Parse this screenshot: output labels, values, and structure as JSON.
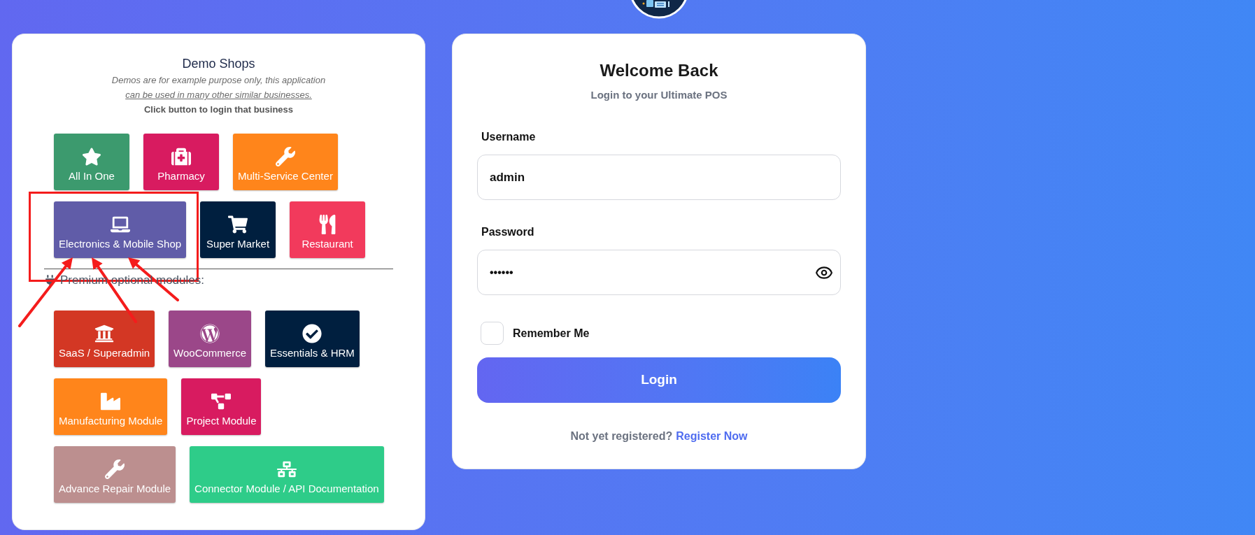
{
  "demo_shops": {
    "title": "Demo Shops",
    "note": "Demos are for example purpose only, this application",
    "note_link": "can be used in many other similar businesses.",
    "instruction": "Click button to login that business",
    "buttons": [
      {
        "label": "All In One",
        "color": "#3c9a6e"
      },
      {
        "label": "Pharmacy",
        "color": "#d81b60"
      },
      {
        "label": "Multi-Service Center",
        "color": "#ff851b"
      },
      {
        "label": "Electronics & Mobile Shop",
        "color": "#605ca8"
      },
      {
        "label": "Super Market",
        "color": "#001f3f"
      },
      {
        "label": "Restaurant",
        "color": "#f23a5c"
      }
    ]
  },
  "modules": {
    "heading": "Premium optional modules:",
    "buttons": [
      {
        "label": "SaaS / Superadmin",
        "color": "#d33724"
      },
      {
        "label": "WooCommerce",
        "color": "#9b4789"
      },
      {
        "label": "Essentials & HRM",
        "color": "#001f3f"
      },
      {
        "label": "Manufacturing Module",
        "color": "#ff851b"
      },
      {
        "label": "Project Module",
        "color": "#d81b60"
      },
      {
        "label": "Advance Repair Module",
        "color": "#bc8f8f"
      },
      {
        "label": "Connector Module / API Documentation",
        "color": "#2ecc89"
      }
    ]
  },
  "login": {
    "title": "Welcome Back",
    "subtitle": "Login to your Ultimate POS",
    "fields": [
      {
        "kind": "text",
        "label": "Username",
        "value": "admin"
      },
      {
        "kind": "password",
        "label": "Password",
        "value": "••••••"
      }
    ],
    "remember": {
      "label": "Remember Me",
      "checked": false
    },
    "submit": "Login",
    "register": {
      "text": "Not yet registered?",
      "link": "Register Now"
    }
  }
}
